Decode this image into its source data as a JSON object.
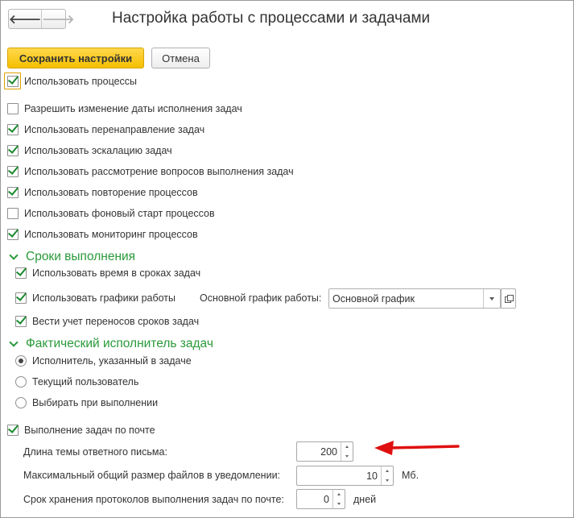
{
  "window": {
    "title": "Настройка работы с процессами и задачами"
  },
  "nav": {
    "back_glyph": "🡐",
    "forward_glyph": "🡒"
  },
  "toolbar": {
    "save_label": "Сохранить настройки",
    "cancel_label": "Отмена"
  },
  "options": {
    "use_processes": {
      "label": "Использовать процессы",
      "checked": true
    },
    "allow_due_date_change": {
      "label": "Разрешить изменение даты исполнения задач",
      "checked": false
    },
    "use_redirect": {
      "label": "Использовать перенаправление задач",
      "checked": true
    },
    "use_escalation": {
      "label": "Использовать эскалацию задач",
      "checked": true
    },
    "use_issue_review": {
      "label": "Использовать рассмотрение вопросов выполнения задач",
      "checked": true
    },
    "use_process_repeat": {
      "label": "Использовать повторение процессов",
      "checked": true
    },
    "use_background_start": {
      "label": "Использовать фоновый старт процессов",
      "checked": false
    },
    "use_process_monitoring": {
      "label": "Использовать мониторинг процессов",
      "checked": true
    }
  },
  "deadlines": {
    "section_title": "Сроки выполнения",
    "use_time": {
      "label": "Использовать время в сроках задач",
      "checked": true
    },
    "use_schedules": {
      "label": "Использовать графики работы",
      "checked": true
    },
    "main_schedule_label": "Основной график работы:",
    "main_schedule_value": "Основной график",
    "track_transfers": {
      "label": "Вести учет переносов сроков задач",
      "checked": true
    }
  },
  "executor": {
    "section_title": "Фактический исполнитель задач",
    "options": [
      {
        "label": "Исполнитель, указанный в задаче",
        "selected": true
      },
      {
        "label": "Текущий пользователь",
        "selected": false
      },
      {
        "label": "Выбирать при выполнении",
        "selected": false
      }
    ]
  },
  "email_tasks": {
    "enabled": {
      "label": "Выполнение задач по почте",
      "checked": true
    },
    "subject_length": {
      "label": "Длина темы ответного письма:",
      "value": "200"
    },
    "max_files_size": {
      "label": "Максимальный общий размер файлов в уведомлении:",
      "value": "10",
      "unit": "Мб."
    },
    "log_retention": {
      "label": "Срок хранения протоколов выполнения задач по почте:",
      "value": "0",
      "unit": "дней"
    }
  },
  "colors": {
    "accent_green": "#2a9a3a",
    "primary_button": "#f5c000",
    "annotation_arrow": "#e01010"
  }
}
